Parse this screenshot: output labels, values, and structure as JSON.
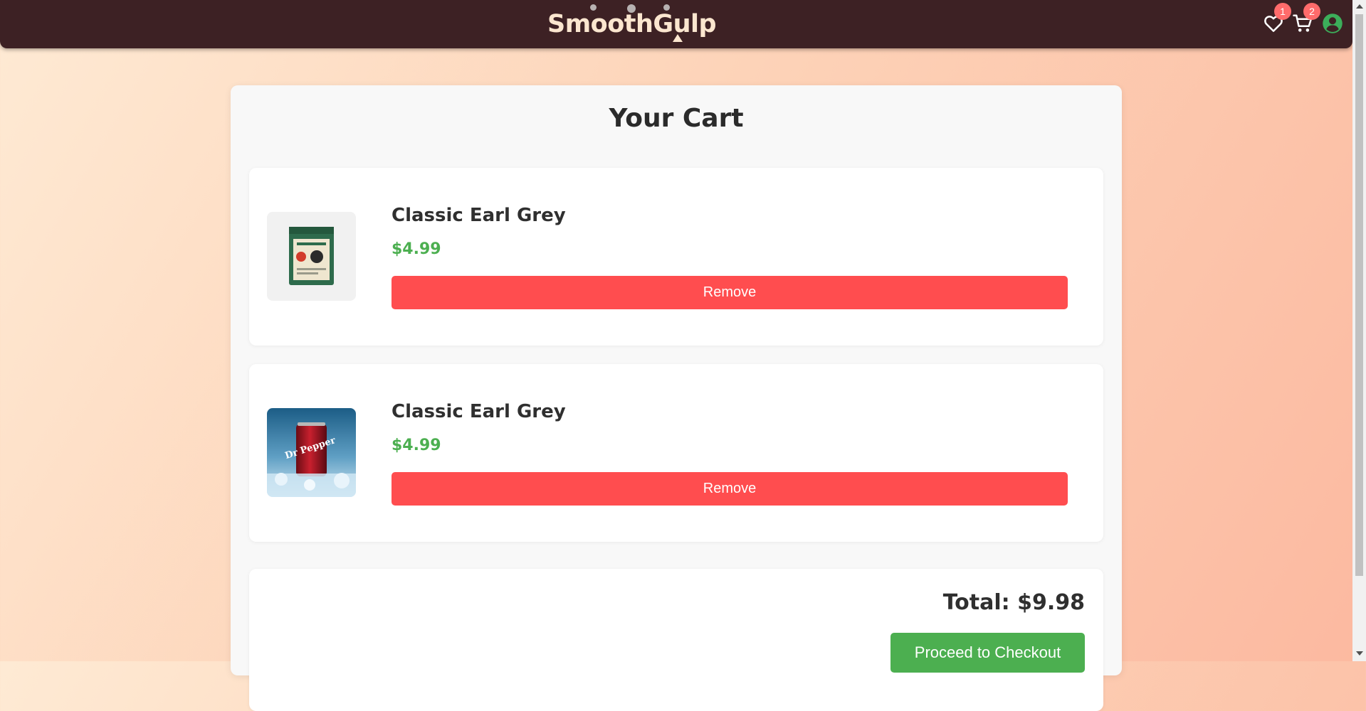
{
  "navbar": {
    "brand": "SmoothGulp",
    "wishlist_count": "1",
    "cart_count": "2"
  },
  "cart": {
    "title": "Your Cart",
    "items": [
      {
        "name": "Classic Earl Grey",
        "price": "$4.99",
        "remove_label": "Remove",
        "image": "earl-grey-tea-pouch"
      },
      {
        "name": "Classic Earl Grey",
        "price": "$4.99",
        "remove_label": "Remove",
        "image": "dr-pepper-can-on-ice"
      }
    ],
    "total": "Total: $9.98",
    "checkout_label": "Proceed to Checkout"
  },
  "colors": {
    "navbar": "#3d2124",
    "brand": "#fbe6cf",
    "price": "#4caf50",
    "remove": "#ff4d4f",
    "checkout": "#4caf50",
    "badge": "#ff6b6b",
    "user_icon": "#3cae5a"
  }
}
